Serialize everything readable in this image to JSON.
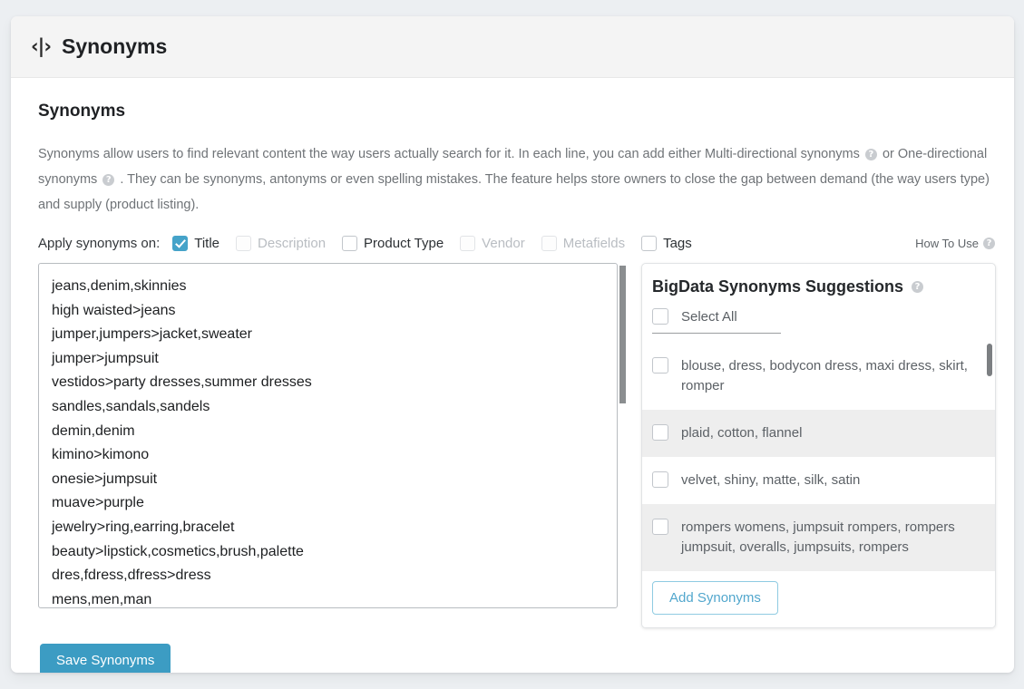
{
  "header": {
    "icon": "code-icon",
    "title": "Synonyms"
  },
  "section": {
    "title": "Synonyms",
    "description_part1": "Synonyms allow users to find relevant content the way users actually search for it. In each line, you can add either Multi-directional synonyms",
    "description_part2": "or One-directional synonyms",
    "description_part3": ". They can be synonyms, antonyms or even spelling mistakes. The feature helps store owners to close the gap between demand (the way users type) and supply (product listing).",
    "help_glyph": "?"
  },
  "apply": {
    "label": "Apply synonyms on:",
    "options": [
      {
        "label": "Title",
        "checked": true,
        "disabled": false
      },
      {
        "label": "Description",
        "checked": false,
        "disabled": true
      },
      {
        "label": "Product Type",
        "checked": false,
        "disabled": false
      },
      {
        "label": "Vendor",
        "checked": false,
        "disabled": true
      },
      {
        "label": "Metafields",
        "checked": false,
        "disabled": true
      },
      {
        "label": "Tags",
        "checked": false,
        "disabled": false
      }
    ],
    "how_to_use": "How To Use"
  },
  "editor": {
    "value": "jeans,denim,skinnies\nhigh waisted>jeans\njumper,jumpers>jacket,sweater\njumper>jumpsuit\nvestidos>party dresses,summer dresses\nsandles,sandals,sandels\ndemin,denim\nkimino>kimono\nonesie>jumpsuit\nmuave>purple\njewelry>ring,earring,bracelet\nbeauty>lipstick,cosmetics,brush,palette\ndres,fdress,dfress>dress\nmens,men,man",
    "placeholder": ""
  },
  "suggestions": {
    "title": "BigData Synonyms Suggestions",
    "select_all_label": "Select All",
    "items": [
      {
        "text": "blouse, dress, bodycon dress, maxi dress, skirt, romper",
        "checked": false
      },
      {
        "text": "plaid, cotton, flannel",
        "checked": false
      },
      {
        "text": "velvet, shiny, matte, silk, satin",
        "checked": false
      },
      {
        "text": "rompers womens, jumpsuit rompers, rompers jumpsuit, overalls, jumpsuits, rompers",
        "checked": false
      }
    ],
    "add_button": "Add Synonyms"
  },
  "actions": {
    "save_label": "Save Synonyms"
  },
  "colors": {
    "accent": "#3c9cc3",
    "accent_light": "#52a7cd",
    "page_bg": "#eceff2",
    "header_bg": "#f4f4f4"
  }
}
